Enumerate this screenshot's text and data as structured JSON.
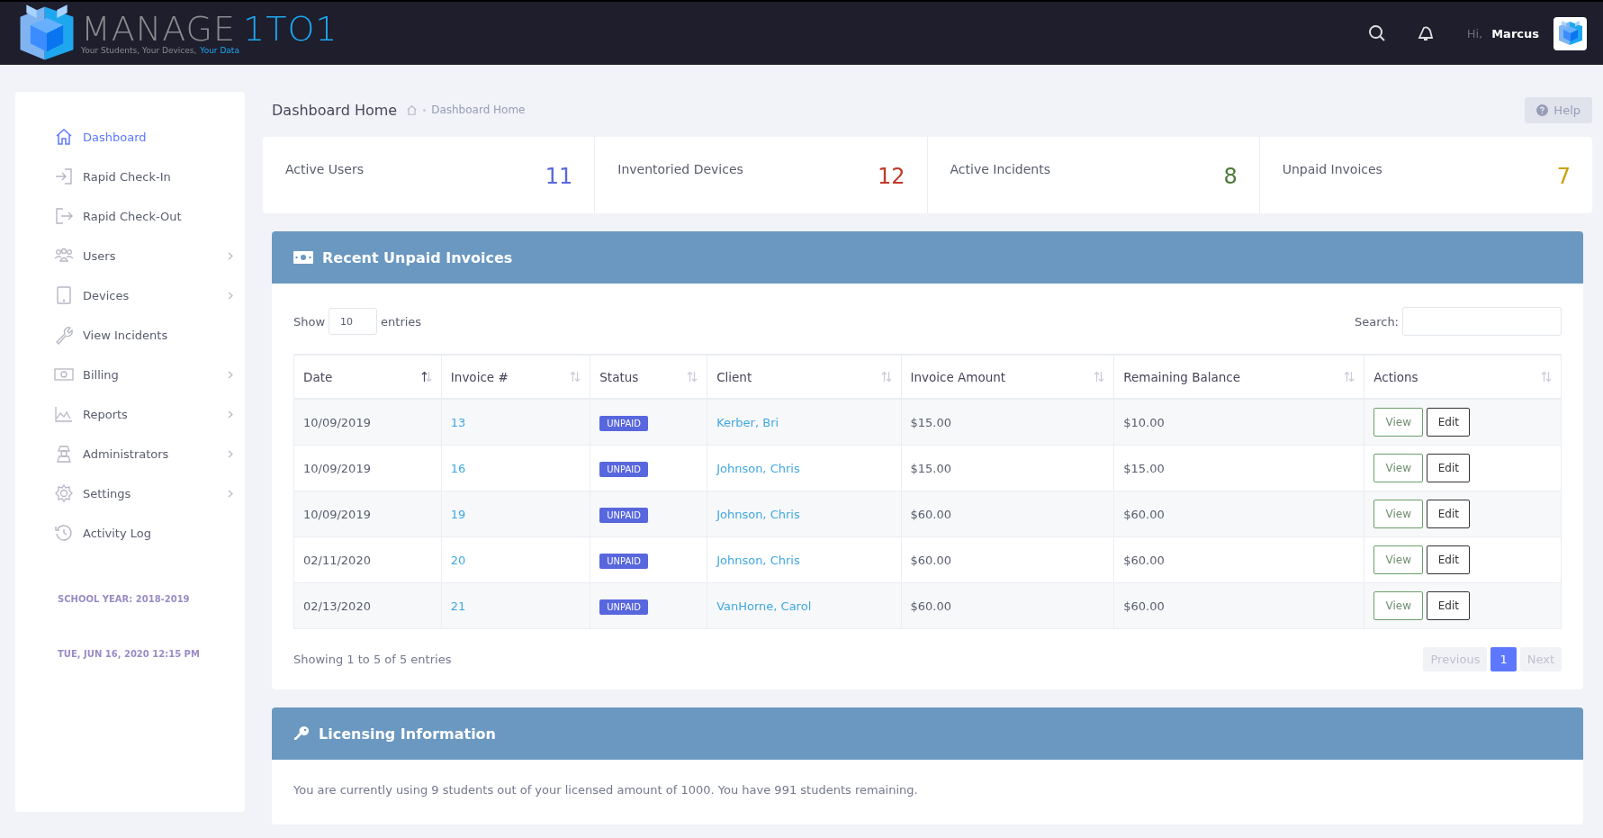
{
  "header": {
    "logo_word": "MANAGE",
    "logo_accent": "1TO1",
    "tagline": "Your Students, Your Devices,",
    "tagline_accent": "Your Data",
    "greeting": "Hi,",
    "user_name": "Marcus"
  },
  "sidebar": {
    "items": [
      {
        "label": "Dashboard",
        "selected": true,
        "expandable": false
      },
      {
        "label": "Rapid Check-In",
        "selected": false,
        "expandable": false
      },
      {
        "label": "Rapid Check-Out",
        "selected": false,
        "expandable": false
      },
      {
        "label": "Users",
        "selected": false,
        "expandable": true
      },
      {
        "label": "Devices",
        "selected": false,
        "expandable": true
      },
      {
        "label": "View Incidents",
        "selected": false,
        "expandable": false
      },
      {
        "label": "Billing",
        "selected": false,
        "expandable": true
      },
      {
        "label": "Reports",
        "selected": false,
        "expandable": true
      },
      {
        "label": "Administrators",
        "selected": false,
        "expandable": true
      },
      {
        "label": "Settings",
        "selected": false,
        "expandable": true
      },
      {
        "label": "Activity Log",
        "selected": false,
        "expandable": false
      }
    ],
    "school_year": "SCHOOL YEAR: 2018-2019",
    "datetime": "TUE, JUN 16, 2020 12:15 PM"
  },
  "page_title": "Dashboard Home",
  "breadcrumb": [
    "Dashboard Home"
  ],
  "help_button": "Help",
  "stats": [
    {
      "label": "Active Users",
      "value": "11",
      "color": "#5867dd"
    },
    {
      "label": "Inventoried Devices",
      "value": "12",
      "color": "#c0392b"
    },
    {
      "label": "Active Incidents",
      "value": "8",
      "color": "#4f7a3a"
    },
    {
      "label": "Unpaid Invoices",
      "value": "7",
      "color": "#c9a20a"
    }
  ],
  "invoices": {
    "title": "Recent Unpaid Invoices",
    "show_label": "Show",
    "page_size": "10",
    "entries_label": "entries",
    "search_label": "Search:",
    "columns": [
      {
        "label": "Date",
        "sorted": true
      },
      {
        "label": "Invoice #",
        "sorted": false
      },
      {
        "label": "Status",
        "sorted": false
      },
      {
        "label": "Client",
        "sorted": false
      },
      {
        "label": "Invoice Amount",
        "sorted": false
      },
      {
        "label": "Remaining Balance",
        "sorted": false
      },
      {
        "label": "Actions",
        "sorted": false
      }
    ],
    "rows": [
      {
        "date": "10/09/2019",
        "invoice": "13",
        "status": "UNPAID",
        "client": "Kerber, Bri",
        "amount": "$15.00",
        "balance": "$10.00",
        "actions": [
          "View",
          "Edit"
        ]
      },
      {
        "date": "10/09/2019",
        "invoice": "16",
        "status": "UNPAID",
        "client": "Johnson, Chris",
        "amount": "$15.00",
        "balance": "$15.00",
        "actions": [
          "View",
          "Edit"
        ]
      },
      {
        "date": "10/09/2019",
        "invoice": "19",
        "status": "UNPAID",
        "client": "Johnson, Chris",
        "amount": "$60.00",
        "balance": "$60.00",
        "actions": [
          "View",
          "Edit"
        ]
      },
      {
        "date": "02/11/2020",
        "invoice": "20",
        "status": "UNPAID",
        "client": "Johnson, Chris",
        "amount": "$60.00",
        "balance": "$60.00",
        "actions": [
          "View",
          "Edit"
        ]
      },
      {
        "date": "02/13/2020",
        "invoice": "21",
        "status": "UNPAID",
        "client": "VanHorne, Carol",
        "amount": "$60.00",
        "balance": "$60.00",
        "actions": [
          "View",
          "Edit"
        ]
      }
    ],
    "summary": "Showing 1 to 5 of 5 entries",
    "pagination": [
      {
        "label": "Previous",
        "selected": false,
        "disabled": true
      },
      {
        "label": "1",
        "selected": true,
        "disabled": false
      },
      {
        "label": "Next",
        "selected": false,
        "disabled": true
      }
    ]
  },
  "licensing": {
    "title": "Licensing Information",
    "text": "You are currently using 9 students out of your licensed amount of 1000. You have 991 students remaining."
  }
}
